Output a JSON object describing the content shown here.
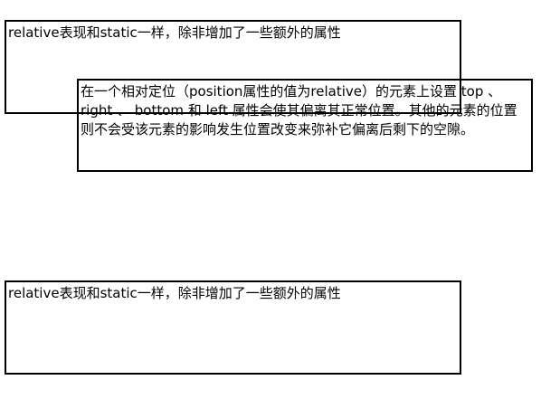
{
  "boxes": {
    "top": {
      "text": "relative表现和static一样，除非增加了一些额外的属性"
    },
    "relative": {
      "text": "在一个相对定位（position属性的值为relative）的元素上设置 top 、right 、 bottom 和 left 属性会使其偏离其正常位置。其他的元素的位置则不会受该元素的影响发生位置改变来弥补它偏离后剩下的空隙。"
    },
    "bottom": {
      "text": "relative表现和static一样，除非增加了一些额外的属性"
    }
  },
  "colors": {
    "border": "#000000",
    "text": "#000000",
    "background": "#ffffff"
  }
}
